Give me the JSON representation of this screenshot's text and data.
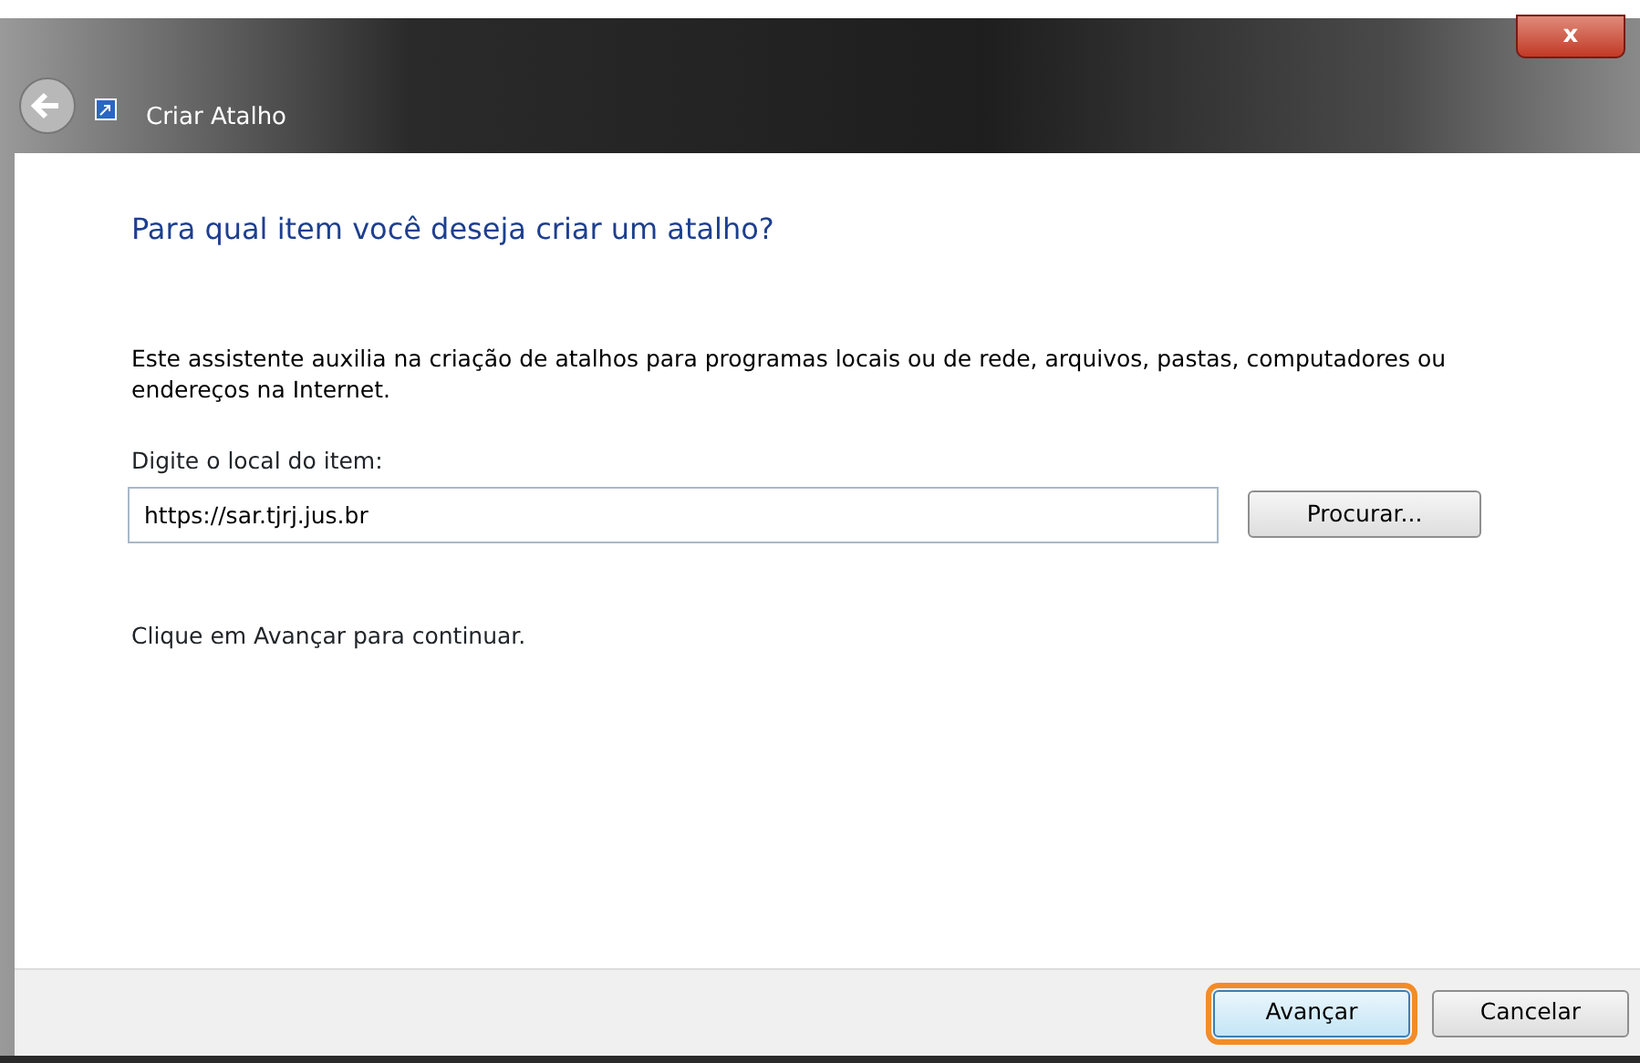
{
  "window": {
    "title": "Criar Atalho",
    "close_label": "x"
  },
  "heading": "Para qual item você deseja criar um atalho?",
  "description": "Este assistente auxilia na criação de atalhos para programas locais ou de rede, arquivos, pastas, computadores ou endereços na Internet.",
  "location": {
    "label": "Digite o local do item:",
    "value": "https://sar.tjrj.jus.br",
    "browse_button": "Procurar..."
  },
  "hint": "Clique em Avançar para continuar.",
  "buttons": [
    {
      "label": "Avançar",
      "highlighted": true
    },
    {
      "label": "Cancelar",
      "highlighted": false
    }
  ]
}
